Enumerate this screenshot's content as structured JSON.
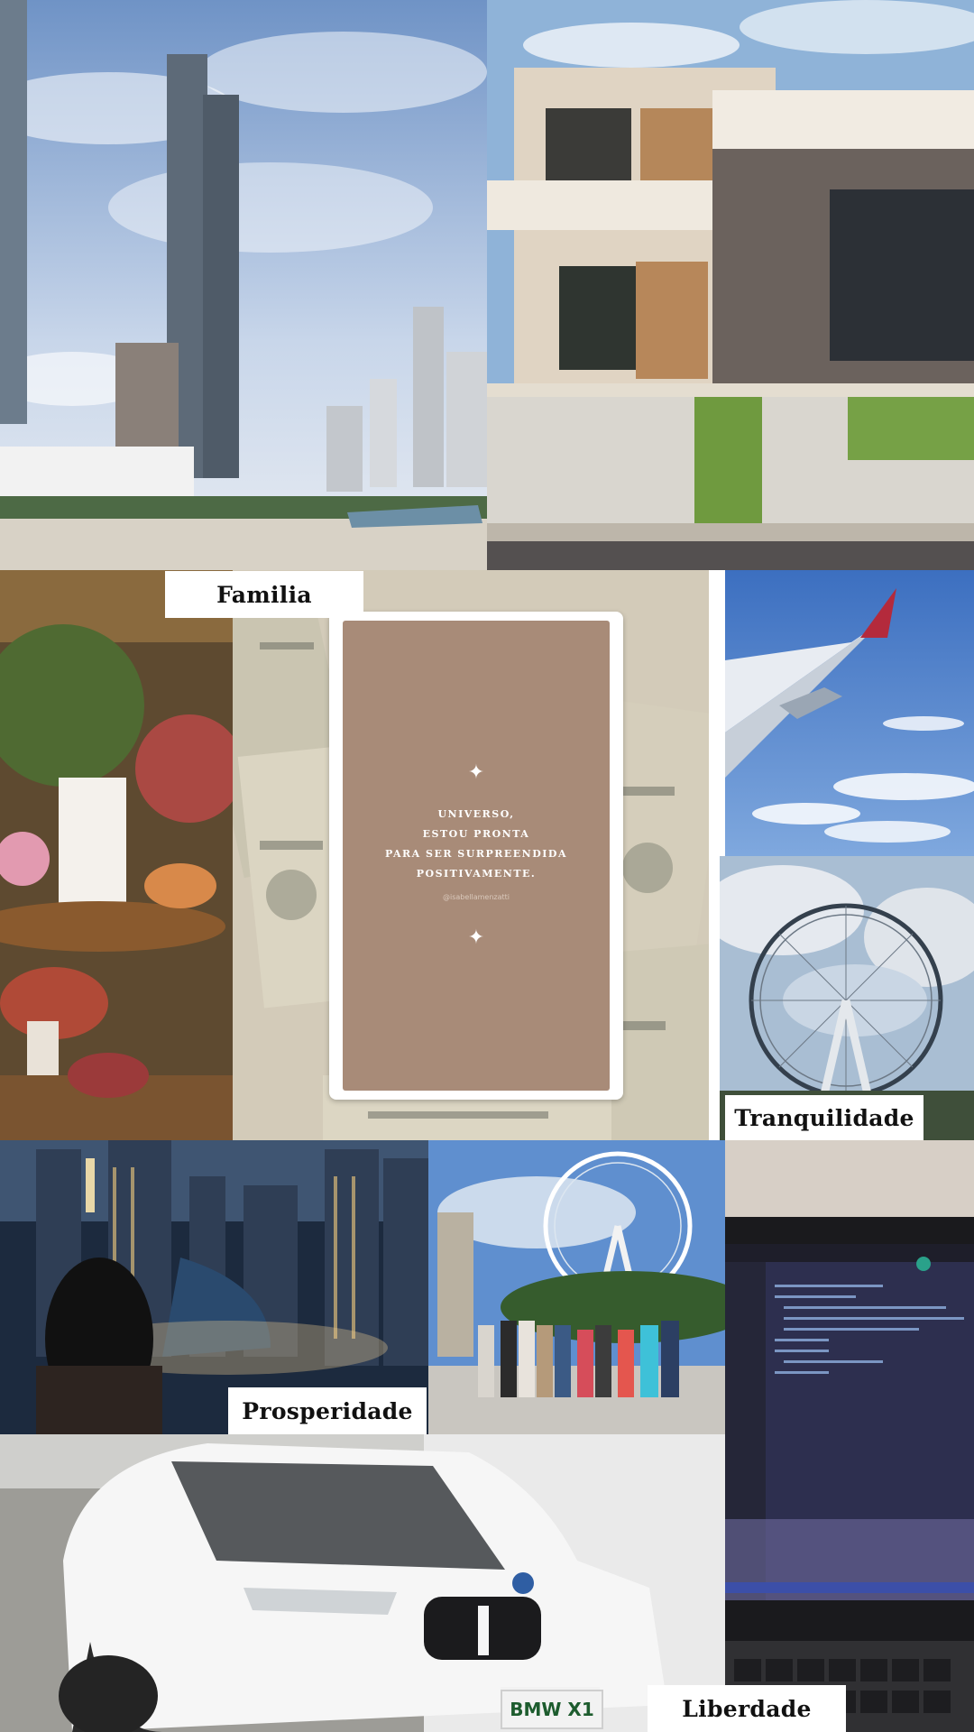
{
  "labels": {
    "familia": "Familia",
    "tranquilidade": "Tranquilidade",
    "prosperidade": "Prosperidade",
    "liberdade": "Liberdade"
  },
  "quote": {
    "lines": [
      "UNIVERSO,",
      "ESTOU PRONTA",
      "PARA SER SURPREENDIDA",
      "POSITIVAMENTE."
    ],
    "handle": "@isabellamenzatti",
    "sparkle_glyph": "✦"
  },
  "car": {
    "plate": "BMW X1"
  },
  "photos": [
    {
      "name": "city-skyline-photo",
      "subject": "skyscrapers by the beach"
    },
    {
      "name": "modern-house-photo",
      "subject": "modern house facade"
    },
    {
      "name": "wedding-cake-photo",
      "subject": "decorated wedding cake table"
    },
    {
      "name": "money-bills-photo",
      "subject": "hundred dollar bills"
    },
    {
      "name": "airplane-wing-photo",
      "subject": "airplane wing above clouds"
    },
    {
      "name": "ferris-wheel-photo",
      "subject": "ferris wheel against sky"
    },
    {
      "name": "night-city-photo",
      "subject": "woman toasting over night city"
    },
    {
      "name": "family-group-photo",
      "subject": "family group in front of ferris wheel"
    },
    {
      "name": "laptop-code-photo",
      "subject": "laptop with code editor"
    },
    {
      "name": "white-suv-photo",
      "subject": "white BMW X1"
    }
  ],
  "colors": {
    "quote_bg": "#a88b78",
    "label_bg": "#ffffff",
    "label_text": "#111111"
  }
}
